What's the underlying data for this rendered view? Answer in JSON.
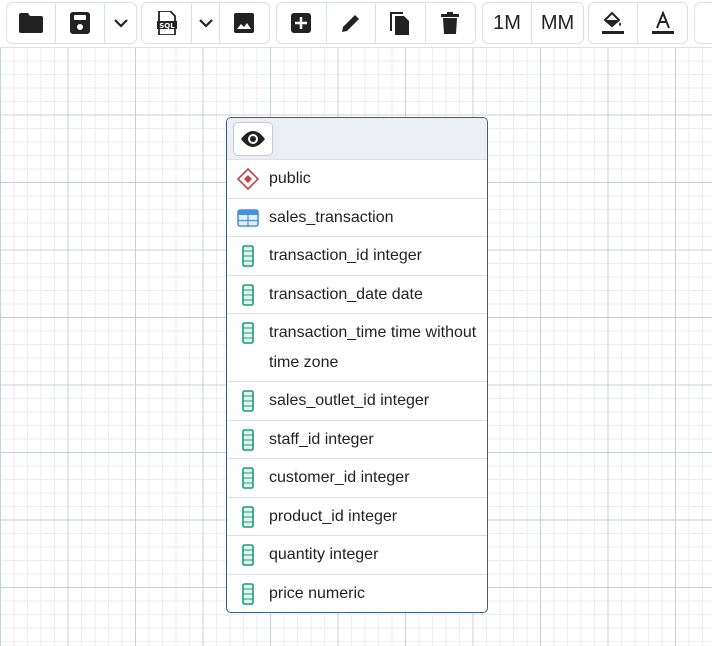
{
  "toolbar": {
    "groups": [
      {
        "buttons": [
          "folder-open-icon",
          "save-icon",
          "chevron-down-icon"
        ]
      },
      {
        "buttons": [
          "sql-file-icon",
          "chevron-down-icon",
          "image-icon"
        ]
      },
      {
        "buttons": [
          "add-box-icon",
          "pencil-icon",
          "clone-icon",
          "trash-icon"
        ]
      },
      {
        "buttons": [
          "1M",
          "MM"
        ]
      },
      {
        "buttons": [
          "fill-color-icon",
          "text-color-icon"
        ]
      }
    ],
    "one_to_many_label": "1M",
    "many_to_many_label": "MM"
  },
  "node": {
    "schema": "public",
    "table": "sales_transaction",
    "columns": [
      "transaction_id integer",
      "transaction_date date",
      "transaction_time time without time zone",
      "sales_outlet_id integer",
      "staff_id integer",
      "customer_id integer",
      "product_id integer",
      "quantity integer",
      "price numeric"
    ]
  },
  "colors": {
    "schema_icon": "#c94040",
    "table_icon": "#4a90d9",
    "column_icon": "#1a9c7a",
    "node_border": "#3a5f8a"
  }
}
